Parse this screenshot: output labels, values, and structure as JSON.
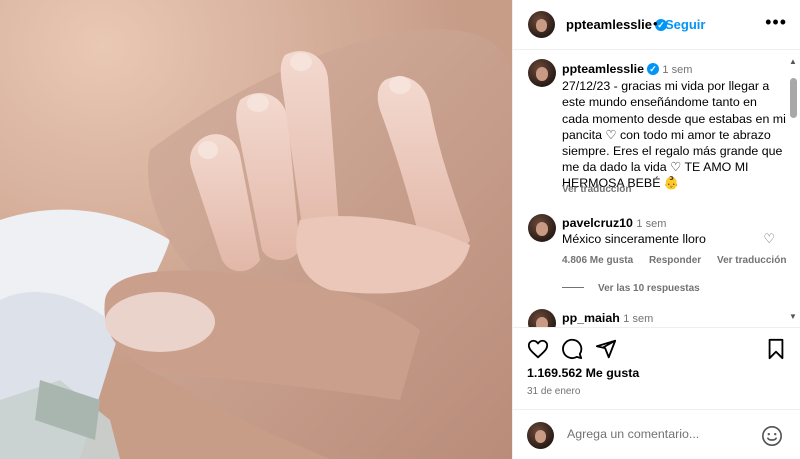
{
  "post": {
    "username": "ppteamlesslie",
    "separator": "•",
    "follow_label": "Seguir",
    "more_icon": "more-options-icon"
  },
  "caption": {
    "username": "ppteamlesslie",
    "time_ago": "1 sem",
    "text": "27/12/23 - gracias mi vida por llegar a este mundo enseñándome tanto en cada momento desde que estabas en mi pancita ♡ con todo mi amor te abrazo siempre. Eres el regalo más grande que me da dado la vida ♡ TE AMO MI HERMOSA BEBÉ 👶",
    "see_translation": "Ver traducción"
  },
  "comments": [
    {
      "username": "pavelcruz10",
      "time_ago": "1 sem",
      "text": "México sinceramente lloro",
      "likes": "4.806 Me gusta",
      "reply": "Responder",
      "translate": "Ver traducción",
      "view_replies": "Ver las 10 respuestas"
    },
    {
      "username": "pp_maiah",
      "time_ago": "1 sem"
    }
  ],
  "footer": {
    "likes": "1.169.562 Me gusta",
    "date": "31 de enero",
    "comment_placeholder": "Agrega un comentario..."
  },
  "colors": {
    "accent": "#0095f6",
    "muted": "#737373",
    "divider": "#efefef"
  }
}
